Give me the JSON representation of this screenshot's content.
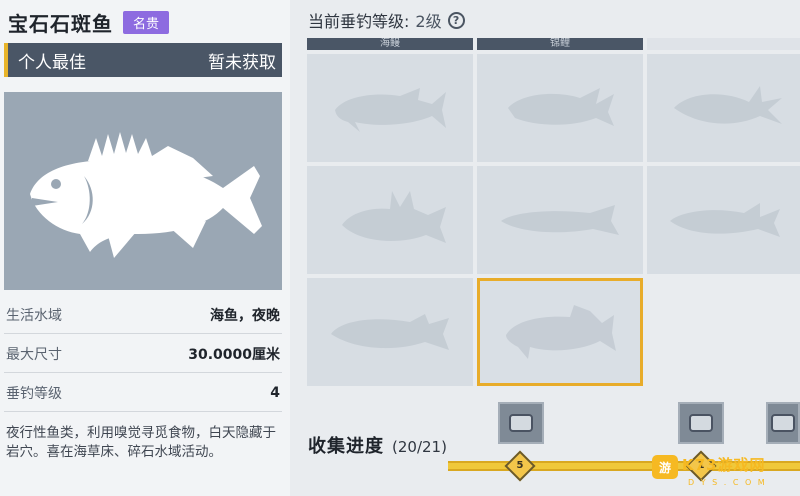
{
  "fish": {
    "name": "宝石石斑鱼",
    "rarity": "名贵",
    "rarity_color": "#8d6be0"
  },
  "personal_best": {
    "label": "个人最佳",
    "value": "暂未获取"
  },
  "stats": [
    {
      "label": "生活水域",
      "value": "海鱼，夜晚"
    },
    {
      "label": "最大尺寸",
      "value": "30.0000厘米"
    },
    {
      "label": "垂钓等级",
      "value": "4"
    }
  ],
  "description": "夜行性鱼类，利用嗅觉寻觅食物，白天隐藏于岩穴。喜在海草床、碎石水域活动。",
  "fishing_level": {
    "label": "当前垂钓等级:",
    "value": "2级",
    "help_icon": "question-circle-icon"
  },
  "grid_tabs": [
    "海鳗",
    "锦鲤",
    ""
  ],
  "grid_cells": [
    {
      "name": "silhouette-1",
      "selected": false
    },
    {
      "name": "silhouette-2",
      "selected": false
    },
    {
      "name": "silhouette-3",
      "selected": false
    },
    {
      "name": "silhouette-4",
      "selected": false
    },
    {
      "name": "silhouette-5",
      "selected": false
    },
    {
      "name": "silhouette-6",
      "selected": false
    },
    {
      "name": "silhouette-7",
      "selected": false
    },
    {
      "name": "silhouette-8",
      "selected": true
    }
  ],
  "collection": {
    "label": "收集进度",
    "count": "(20/21)",
    "milestones": [
      "5",
      "1"
    ],
    "accent": "#f0c83a"
  },
  "watermark": {
    "icon_text": "游",
    "text": "K73游戏网",
    "sub": "D Y S . C O M"
  },
  "colors": {
    "selected_border": "#e8ac2a",
    "header_bar": "#4a5666"
  }
}
